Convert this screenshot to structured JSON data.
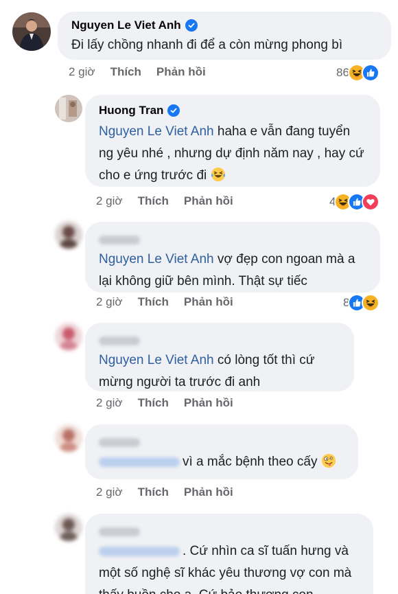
{
  "comments": [
    {
      "author": "Nguyen Le Viet Anh",
      "verified": true,
      "text": "Đi lấy chồng nhanh đi để a còn mừng phong bì",
      "time": "2 giờ",
      "like_label": "Thích",
      "reply_label": "Phản hồi",
      "reaction_count": "86",
      "reactions": [
        "haha-icon",
        "like-icon"
      ]
    },
    {
      "author": "Huong Tran",
      "verified": true,
      "mention": "Nguyen Le Viet Anh",
      "text": " haha e vẫn đang tuyển ng yêu nhé ,  nhưng dự định năm nay , hay cứ cho e ứng trước đi",
      "emoji": "tears-of-joy-emoji",
      "time": "2 giờ",
      "like_label": "Thích",
      "reply_label": "Phản hồi",
      "reaction_count": "4",
      "reactions": [
        "haha-icon",
        "like-icon",
        "love-icon"
      ]
    },
    {
      "mention": "Nguyen Le Viet Anh",
      "text": " vợ đẹp con ngoan mà a lại không giữ bên mình. Thật sự tiếc",
      "time": "2 giờ",
      "like_label": "Thích",
      "reply_label": "Phản hồi",
      "reaction_count": "8",
      "reactions": [
        "like-icon",
        "haha-icon"
      ]
    },
    {
      "mention": "Nguyen Le Viet Anh",
      "text": " có lòng tốt thì cứ mừng người ta trước đi anh",
      "time": "2 giờ",
      "like_label": "Thích",
      "reply_label": "Phản hồi"
    },
    {
      "text": "vì a mắc bệnh theo cấy",
      "emoji": "zany-face-emoji",
      "time": "2 giờ",
      "like_label": "Thích",
      "reply_label": "Phản hồi"
    },
    {
      "text": ". Cứ nhìn ca sĩ tuấn hưng và một số nghệ sĩ khác yêu thương vợ con mà thấy buồn cho a. Cứ bảo thương con,"
    }
  ],
  "colors": {
    "bubble": "#eff1f4",
    "mention": "#2d5f9f",
    "meta": "#65676b",
    "like": "#1877f2",
    "haha": "#f7b125"
  }
}
